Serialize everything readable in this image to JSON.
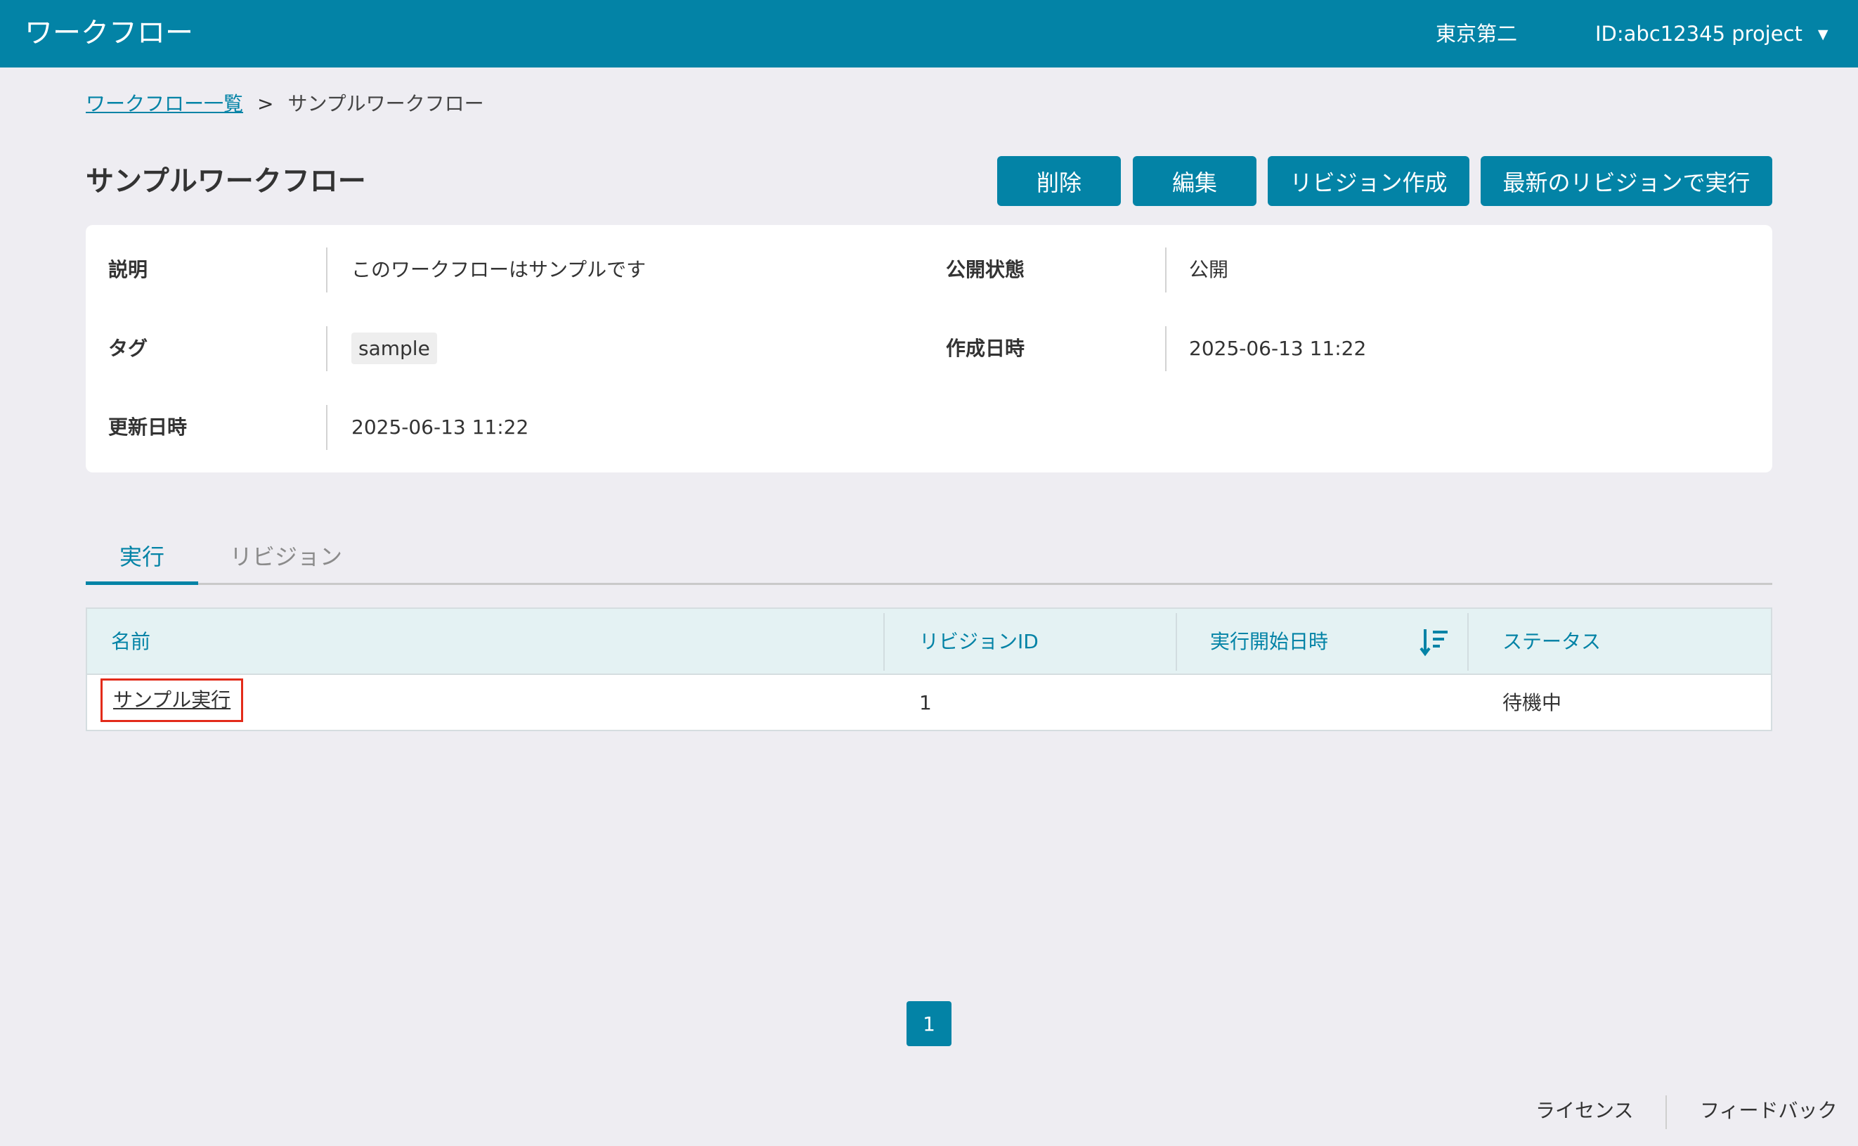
{
  "header": {
    "app_title": "ワークフロー",
    "org_name": "東京第二",
    "project": "ID:abc12345 project",
    "dropdown_icon": "caret-down-icon"
  },
  "breadcrumb": {
    "parent": "ワークフロー一覧",
    "separator": ">",
    "current": "サンプルワークフロー"
  },
  "page": {
    "title": "サンプルワークフロー"
  },
  "actions": {
    "delete": "削除",
    "edit": "編集",
    "create_revision": "リビジョン作成",
    "run_latest": "最新のリビジョンで実行"
  },
  "details": {
    "description_label": "説明",
    "description_value": "このワークフローはサンプルです",
    "visibility_label": "公開状態",
    "visibility_value": "公開",
    "tags_label": "タグ",
    "tags": [
      "sample"
    ],
    "created_label": "作成日時",
    "created_value": "2025-06-13 11:22",
    "updated_label": "更新日時",
    "updated_value": "2025-06-13 11:22"
  },
  "tabs": [
    {
      "label": "実行",
      "active": true
    },
    {
      "label": "リビジョン",
      "active": false
    }
  ],
  "table": {
    "columns": [
      "名前",
      "リビジョンID",
      "実行開始日時",
      "ステータス"
    ],
    "sort_icon": "sort-descending-icon",
    "rows": [
      {
        "name": "サンプル実行",
        "revision_id": "1",
        "started_at": "",
        "status": "待機中"
      }
    ]
  },
  "pagination": {
    "current_page": "1"
  },
  "footer": {
    "license": "ライセンス",
    "feedback": "フィードバック"
  },
  "colors": {
    "primary": "#0383a6",
    "background": "#eeedf2",
    "highlight_border": "#e32b1a",
    "table_header_bg": "#e4f2f3"
  }
}
